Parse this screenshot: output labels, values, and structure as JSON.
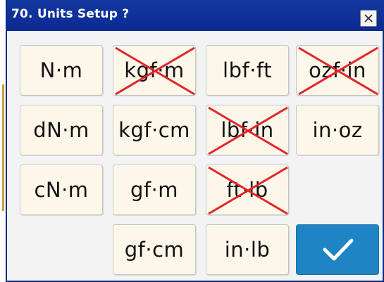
{
  "dialog": {
    "title": "70. Units Setup ?",
    "close_icon": "close-icon",
    "confirm_icon": "checkmark-icon",
    "confirm_color": "#1e84c4",
    "title_bar_color": "#0b2a92",
    "disabled_mark_color": "#e0262a"
  },
  "units": [
    {
      "label": "N·m",
      "disabled": false
    },
    {
      "label": "kgf·m",
      "disabled": true
    },
    {
      "label": "lbf·ft",
      "disabled": false
    },
    {
      "label": "ozf·in",
      "disabled": true
    },
    {
      "label": "dN·m",
      "disabled": false
    },
    {
      "label": "kgf·cm",
      "disabled": false
    },
    {
      "label": "lbf·in",
      "disabled": true
    },
    {
      "label": "in·oz",
      "disabled": false
    },
    {
      "label": "cN·m",
      "disabled": false
    },
    {
      "label": "gf·m",
      "disabled": false
    },
    {
      "label": "ft·lb",
      "disabled": true
    },
    {
      "label": "gf·cm",
      "disabled": false
    },
    {
      "label": "in·lb",
      "disabled": false
    }
  ]
}
